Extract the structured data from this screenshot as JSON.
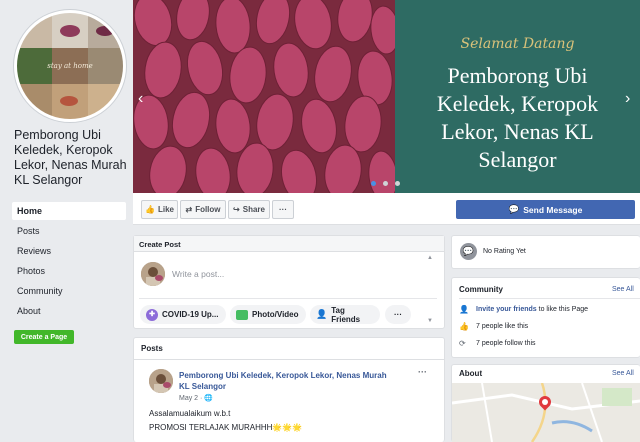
{
  "page": {
    "name": "Pemboroong Ubi Keledek, Keropok Lekor, Nenas Murah KL Selangor"
  },
  "sidebar": {
    "title": "Pemborong Ubi Keledek, Keropok Lekor, Nenas Murah KL Selangor",
    "items": [
      {
        "label": "Home"
      },
      {
        "label": "Posts"
      },
      {
        "label": "Reviews"
      },
      {
        "label": "Photos"
      },
      {
        "label": "Community"
      },
      {
        "label": "About"
      }
    ],
    "create_page_label": "Create a Page"
  },
  "cover": {
    "greeting": "Selamat Datang",
    "headline": "Pemborong Ubi Keledek, Keropok Lekor, Nenas KL Selangor",
    "headline_lines": [
      "Pemborong Ubi",
      "Keledek, Keropok",
      "Lekor, Nenas KL",
      "Selangor"
    ],
    "bg_color": "#2e6b63"
  },
  "actions": {
    "like": "Like",
    "follow": "Follow",
    "share": "Share",
    "more": "···",
    "send_message": "Send Message"
  },
  "create_post": {
    "title": "Create Post",
    "placeholder": "Write a post...",
    "covid": "COVID-19 Up...",
    "photo": "Photo/Video",
    "tag": "Tag Friends",
    "more": "···"
  },
  "posts": {
    "title": "Posts",
    "author": "Pemborong Ubi Keledek, Keropok Lekor, Nenas Murah KL Selangor",
    "author_lines": [
      "Pemborong Ubi Keledek, Keropok Lekor, Nenas Murah",
      "KL Selangor"
    ],
    "date": "May 2 · ",
    "more": "···",
    "line1": "Assalamualaikum w.b.t",
    "line2": "PROMOSI TERLAJAK MURAHHH🌟🌟🌟"
  },
  "right": {
    "rating": "No Rating Yet",
    "community_title": "Community",
    "see_all": "See All",
    "invite": "Invite your friends",
    "invite_rest": " to like this Page",
    "likes": "7 people like this",
    "follows": "7 people follow this",
    "about_title": "About",
    "about_see_all": "See All"
  },
  "colors": {
    "accent": "#4267b2",
    "green": "#42b72a",
    "link": "#385898"
  }
}
